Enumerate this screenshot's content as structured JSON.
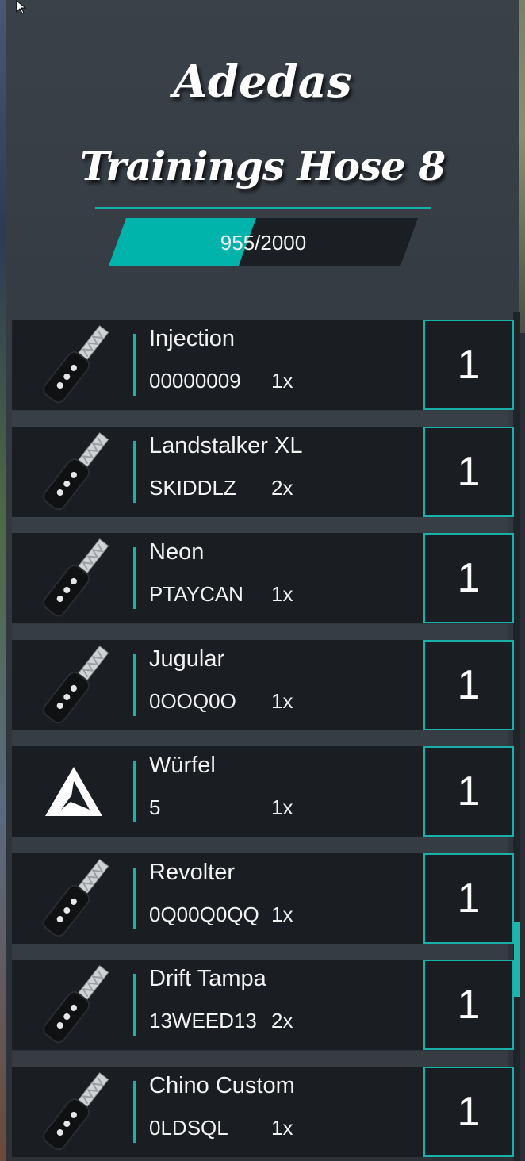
{
  "title": {
    "line1": "Adedas",
    "line2": "Trainings Hose 8"
  },
  "progress": {
    "current": 955,
    "max": 2000,
    "label": "955/2000",
    "fill_color": "#00b4ab"
  },
  "accent_color": "#14b1ab",
  "items": [
    {
      "name": "Injection",
      "plate": "00000009",
      "count": "1x",
      "quantity": "1",
      "icon": "car-key-icon"
    },
    {
      "name": "Landstalker XL",
      "plate": "SKIDDLZ",
      "count": "2x",
      "quantity": "1",
      "icon": "car-key-icon"
    },
    {
      "name": "Neon",
      "plate": "PTAYCAN",
      "count": "1x",
      "quantity": "1",
      "icon": "car-key-icon"
    },
    {
      "name": "Jugular",
      "plate": "0OOQ0O",
      "count": "1x",
      "quantity": "1",
      "icon": "car-key-icon"
    },
    {
      "name": "Würfel",
      "plate": "5",
      "count": "1x",
      "quantity": "1",
      "icon": "triangle-logo-icon"
    },
    {
      "name": "Revolter",
      "plate": "0Q00Q0QQ",
      "count": "1x",
      "quantity": "1",
      "icon": "car-key-icon"
    },
    {
      "name": "Drift Tampa",
      "plate": "13WEED13",
      "count": "2x",
      "quantity": "1",
      "icon": "car-key-icon"
    },
    {
      "name": "Chino Custom",
      "plate": "0LDSQL",
      "count": "1x",
      "quantity": "1",
      "icon": "car-key-icon"
    }
  ]
}
